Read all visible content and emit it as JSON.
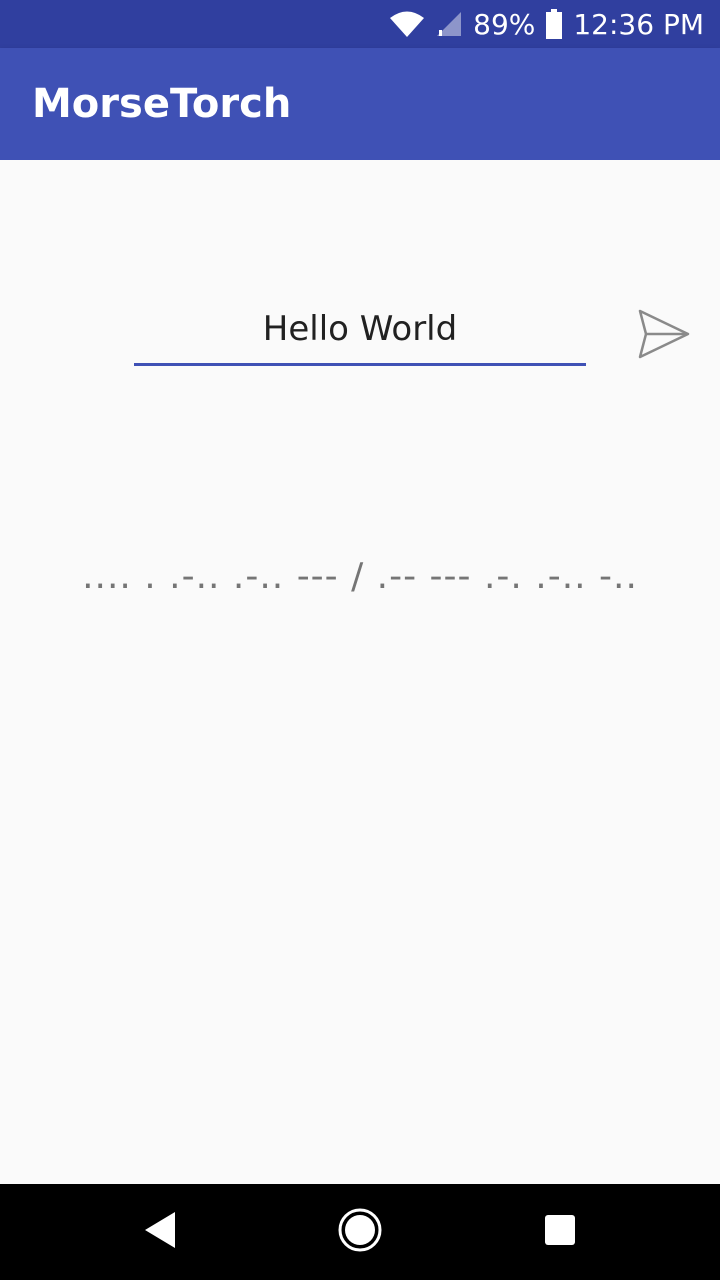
{
  "status_bar": {
    "battery_percent": "89%",
    "time": "12:36 PM",
    "icons": [
      "wifi-icon",
      "cell-signal-icon",
      "battery-icon"
    ]
  },
  "app_bar": {
    "title": "MorseTorch"
  },
  "main": {
    "input_value": "Hello World",
    "send_icon": "send-icon",
    "morse_text": ".... . .-.. .-.. --- / .-- --- .-. .-.. -.."
  },
  "nav_bar": {
    "icons": [
      "back-icon",
      "home-icon",
      "recents-icon"
    ]
  },
  "colors": {
    "status_bar": "#303f9f",
    "app_bar": "#3f51b5",
    "accent": "#3f51b5",
    "background": "#fafafa",
    "morse_text": "#757575"
  }
}
